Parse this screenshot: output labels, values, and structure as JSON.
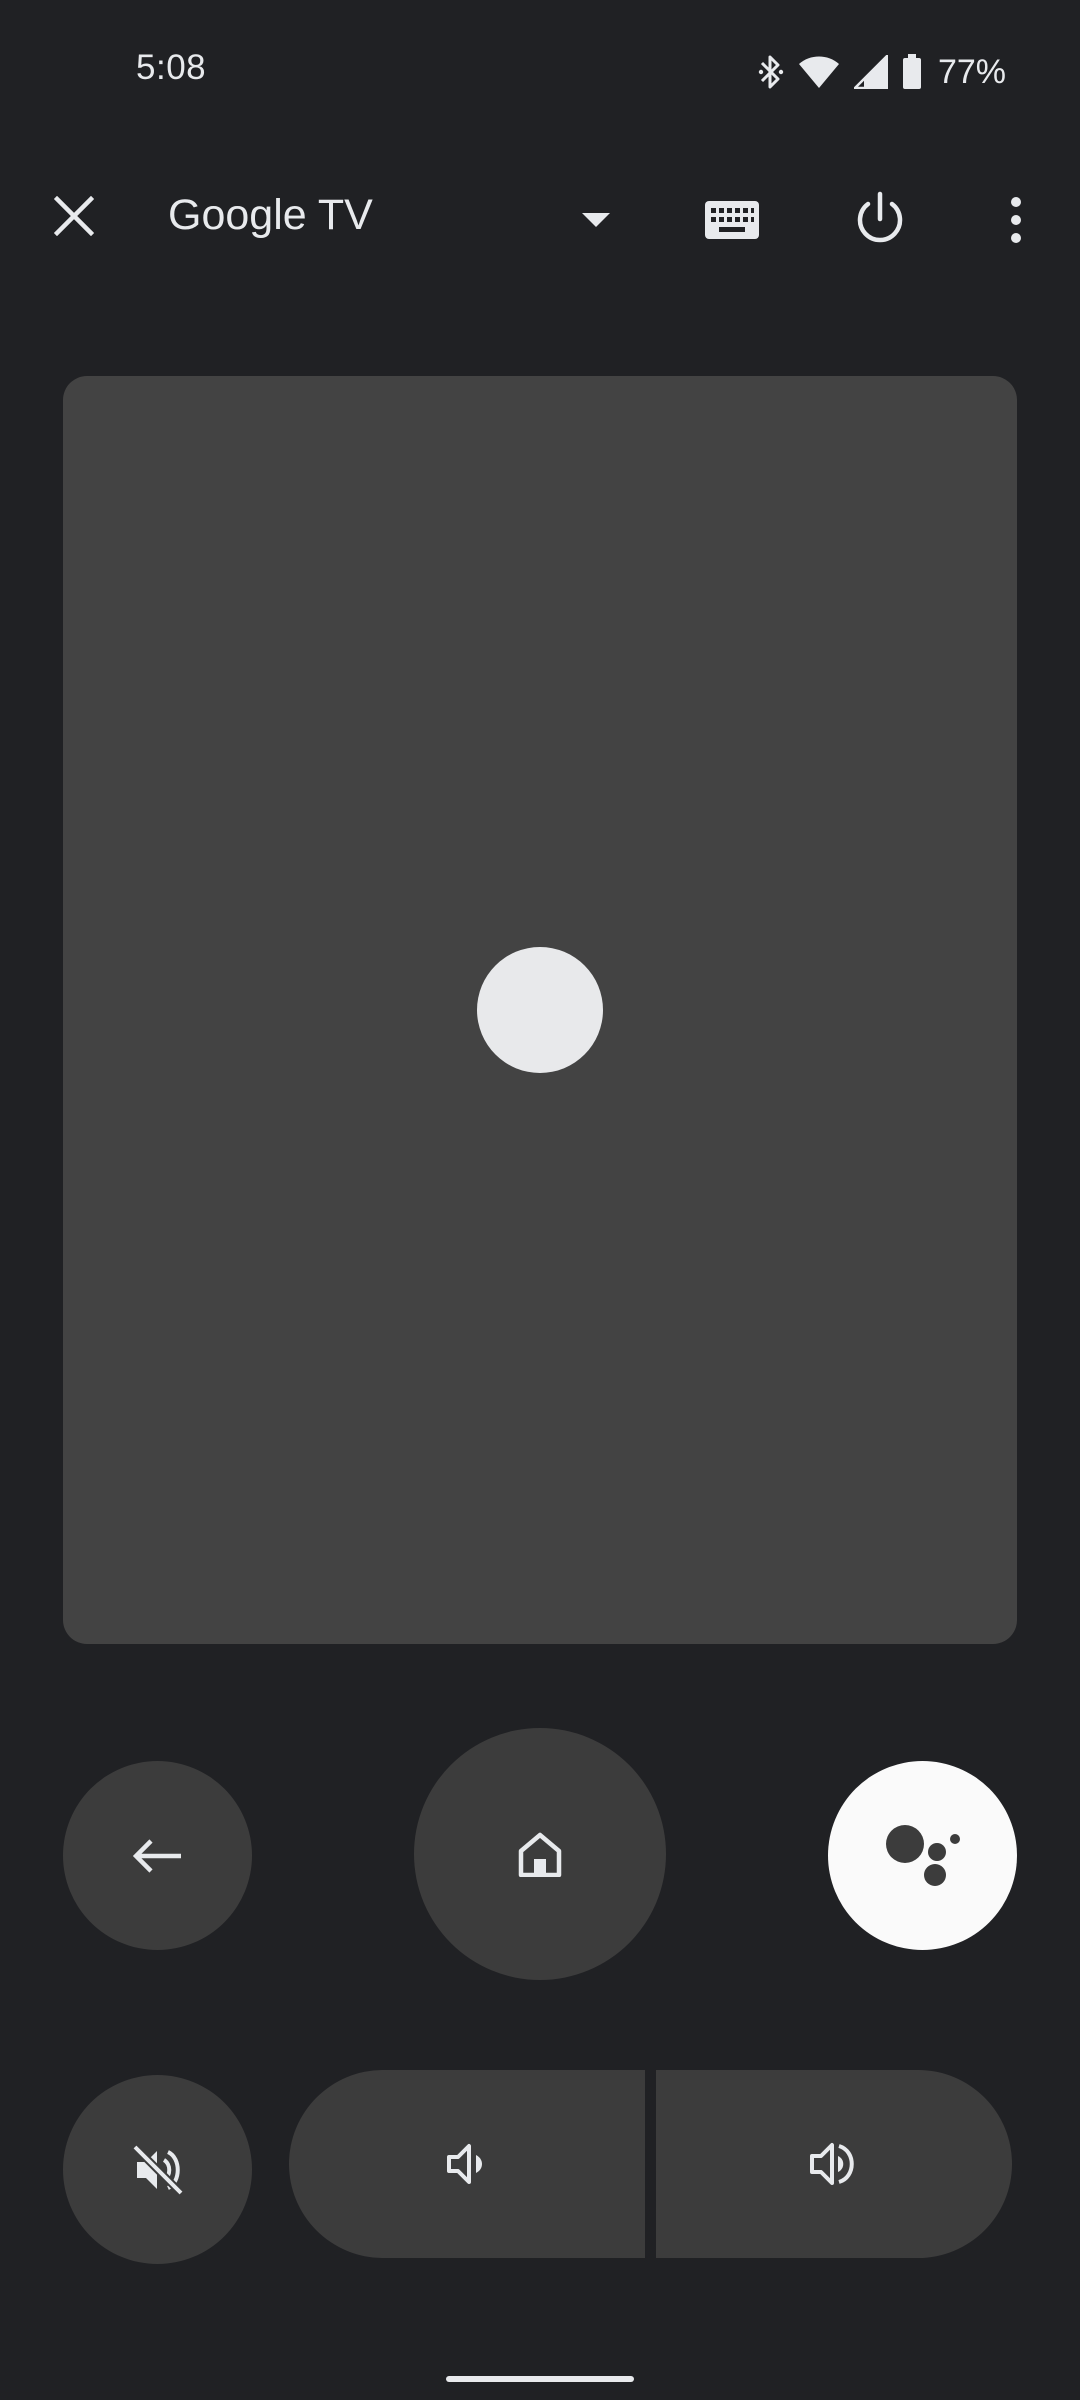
{
  "status_bar": {
    "time": "5:08",
    "battery": "77%",
    "icons": [
      "bluetooth-icon",
      "wifi-icon",
      "signal-icon",
      "battery-icon"
    ]
  },
  "top_bar": {
    "device_name": "Google TV",
    "icons": {
      "close": "close-icon",
      "dropdown": "dropdown-arrow-icon",
      "keyboard": "keyboard-icon",
      "power": "power-icon",
      "more": "more-vert-icon"
    }
  },
  "remote": {
    "touchpad": "touchpad",
    "buttons": [
      "back-arrow-icon",
      "home-icon",
      "google-assistant-icon",
      "volume-mute-icon",
      "volume-down-icon",
      "volume-up-icon"
    ]
  },
  "colors": {
    "background": "#202124",
    "touchpad": "#434343",
    "button": "#3c3c3c",
    "assistant_button": "#fafafa",
    "foreground": "#e8eaed"
  }
}
